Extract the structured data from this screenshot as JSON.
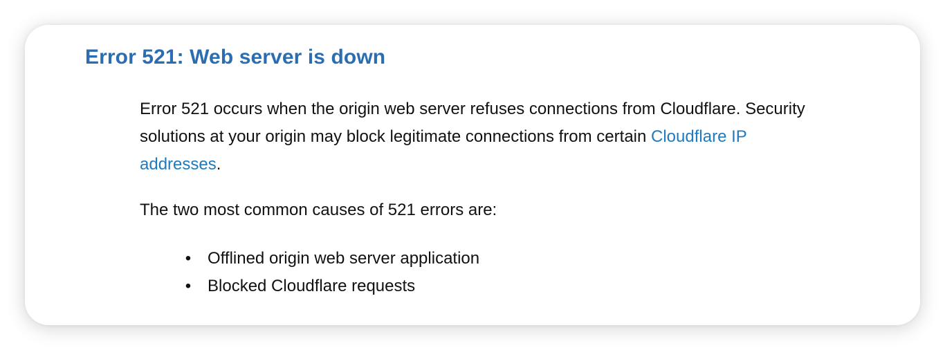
{
  "article": {
    "title": "Error 521: Web server is down",
    "intro_text": "Error 521 occurs when the origin web server refuses connections from Cloudflare. Security solutions at your origin may block legitimate connections from certain ",
    "intro_link": "Cloudflare IP addresses",
    "intro_end": ".",
    "causes_heading": "The two most common causes of 521 errors are:",
    "bullet": "•",
    "causes": [
      "Offlined origin web server application",
      "Blocked Cloudflare requests"
    ]
  },
  "colors": {
    "title": "#2a6db0",
    "link": "#1f7bbf",
    "text": "#111111"
  }
}
